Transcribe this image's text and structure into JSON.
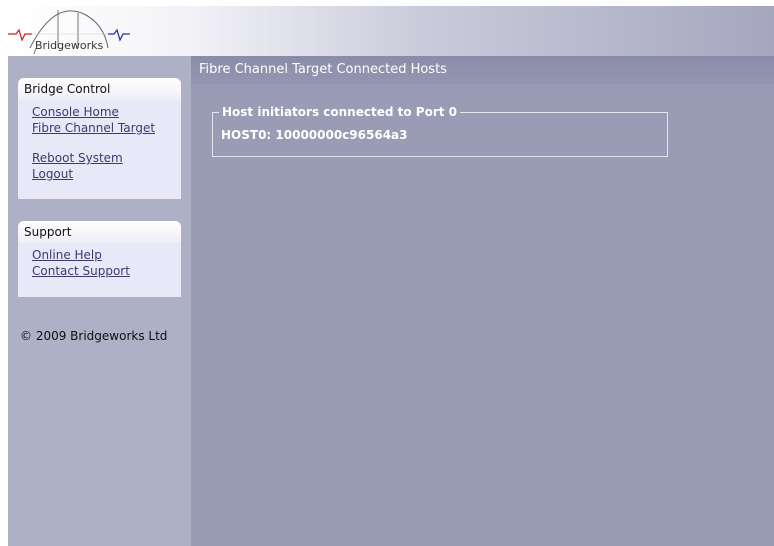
{
  "brand": {
    "name": "Bridgeworks"
  },
  "sidebar": {
    "bridge_control": {
      "title": "Bridge Control",
      "links": [
        "Console Home",
        "Fibre Channel Target",
        "Reboot System",
        "Logout"
      ]
    },
    "support": {
      "title": "Support",
      "links": [
        "Online Help",
        "Contact Support"
      ]
    },
    "copyright": "© 2009 Bridgeworks Ltd"
  },
  "main": {
    "title": "Fibre Channel Target Connected Hosts",
    "group": {
      "legend": "Host initiators connected to Port 0",
      "host_line": "HOST0: 10000000c96564a3"
    }
  },
  "colors": {
    "background": "#9a9bb4",
    "sidebar": "#aeb0c6",
    "link": "#3b3b6e"
  }
}
